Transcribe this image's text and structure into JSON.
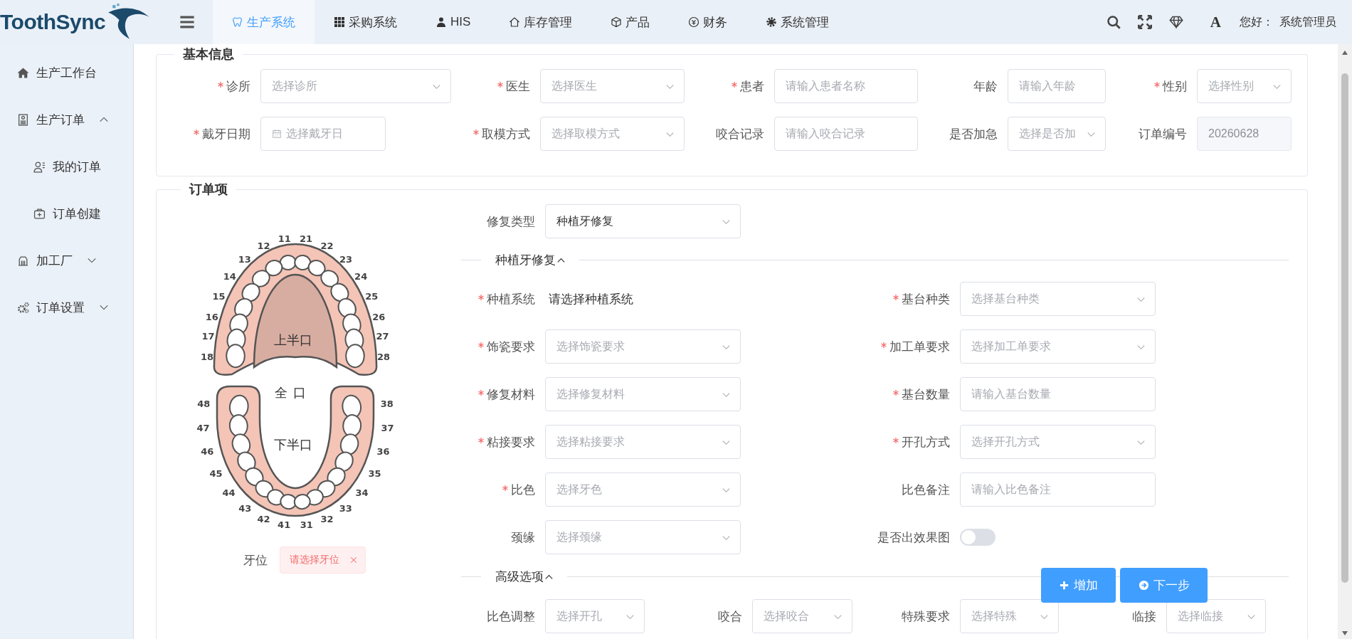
{
  "header": {
    "logo": "ToothSync",
    "nav": [
      {
        "label": "生产系统",
        "selected": true
      },
      {
        "label": "采购系统",
        "selected": false
      },
      {
        "label": "HIS",
        "selected": false
      },
      {
        "label": "库存管理",
        "selected": false
      },
      {
        "label": "产品",
        "selected": false
      },
      {
        "label": "财务",
        "selected": false
      },
      {
        "label": "系统管理",
        "selected": false
      }
    ],
    "font_button": "A",
    "greeting": "您好：",
    "user": "系统管理员"
  },
  "sidebar": {
    "items": [
      {
        "label": "生产工作台"
      },
      {
        "label": "生产订单",
        "expanded": true,
        "children": [
          {
            "label": "我的订单"
          },
          {
            "label": "订单创建"
          }
        ]
      },
      {
        "label": "加工厂",
        "expanded": false
      },
      {
        "label": "订单设置",
        "expanded": false
      }
    ]
  },
  "basic_info": {
    "title": "基本信息",
    "rows": [
      [
        {
          "label": "诊所",
          "required": true,
          "kind": "select",
          "placeholder": "选择诊所"
        },
        {
          "label": "医生",
          "required": true,
          "kind": "select",
          "placeholder": "选择医生"
        },
        {
          "label": "患者",
          "required": true,
          "kind": "input",
          "placeholder": "请输入患者名称"
        },
        {
          "label": "年龄",
          "required": false,
          "kind": "input",
          "placeholder": "请输入年龄"
        },
        {
          "label": "性别",
          "required": true,
          "kind": "select",
          "placeholder": "选择性别"
        }
      ],
      [
        {
          "label": "戴牙日期",
          "required": true,
          "kind": "date",
          "placeholder": "选择戴牙日"
        },
        {
          "label": "取模方式",
          "required": true,
          "kind": "select",
          "placeholder": "选择取模方式"
        },
        {
          "label": "咬合记录",
          "required": false,
          "kind": "input",
          "placeholder": "请输入咬合记录"
        },
        {
          "label": "是否加急",
          "required": false,
          "kind": "select",
          "placeholder": "选择是否加"
        },
        {
          "label": "订单编号",
          "required": false,
          "kind": "readonly",
          "value": "20260628"
        }
      ]
    ]
  },
  "order_items": {
    "title": "订单项",
    "tooth_chart": {
      "upper_label": "上半口",
      "full_label": "全口",
      "lower_label": "下半口",
      "upper_left_side": [
        "11",
        "12",
        "13",
        "14",
        "15",
        "16",
        "17",
        "18"
      ],
      "upper_right_side": [
        "21",
        "22",
        "23",
        "24",
        "25",
        "26",
        "27",
        "28"
      ],
      "lower_left_side": [
        "48",
        "47",
        "46",
        "45",
        "44",
        "43",
        "42",
        "41"
      ],
      "lower_right_side": [
        "38",
        "37",
        "36",
        "35",
        "34",
        "33",
        "32",
        "31"
      ]
    },
    "tooth_position": {
      "label": "牙位",
      "tag": "请选择牙位"
    },
    "repair_type": [
      {
        "label": "修复类型",
        "required": false,
        "kind": "select",
        "value": "种植牙修复"
      }
    ],
    "sections": [
      {
        "title": "种植牙修复",
        "expanded": true,
        "fields": [
          {
            "label": "种植系统",
            "required": true,
            "kind": "text",
            "value": "请选择种植系统"
          },
          {
            "label": "基台种类",
            "required": true,
            "kind": "select",
            "placeholder": "选择基台种类"
          },
          {
            "label": "饰瓷要求",
            "required": true,
            "kind": "select",
            "placeholder": "选择饰瓷要求"
          },
          {
            "label": "加工单要求",
            "required": true,
            "kind": "select",
            "placeholder": "选择加工单要求"
          },
          {
            "label": "修复材料",
            "required": true,
            "kind": "select",
            "placeholder": "选择修复材料"
          },
          {
            "label": "基台数量",
            "required": true,
            "kind": "input",
            "placeholder": "请输入基台数量"
          },
          {
            "label": "粘接要求",
            "required": true,
            "kind": "select",
            "placeholder": "选择粘接要求"
          },
          {
            "label": "开孔方式",
            "required": true,
            "kind": "select",
            "placeholder": "选择开孔方式"
          },
          {
            "label": "比色",
            "required": true,
            "kind": "select",
            "placeholder": "选择牙色"
          },
          {
            "label": "比色备注",
            "required": false,
            "kind": "input",
            "placeholder": "请输入比色备注"
          },
          {
            "label": "颈缘",
            "required": false,
            "kind": "select",
            "placeholder": "选择颈缘"
          },
          {
            "label": "是否出效果图",
            "required": false,
            "kind": "switch",
            "on": false
          }
        ]
      },
      {
        "title": "高级选项",
        "expanded": true,
        "fields": [
          {
            "label": "比色调整",
            "required": false,
            "kind": "select",
            "placeholder": "选择开孔"
          },
          {
            "label": "咬合",
            "required": false,
            "kind": "select",
            "placeholder": "选择咬合"
          },
          {
            "label": "特殊要求",
            "required": false,
            "kind": "select",
            "placeholder": "选择特殊"
          },
          {
            "label": "临接",
            "required": false,
            "kind": "select",
            "placeholder": "选择临接"
          }
        ]
      }
    ],
    "buttons": [
      {
        "label": "增加",
        "kind": "add"
      },
      {
        "label": "下一步",
        "kind": "next"
      }
    ]
  }
}
